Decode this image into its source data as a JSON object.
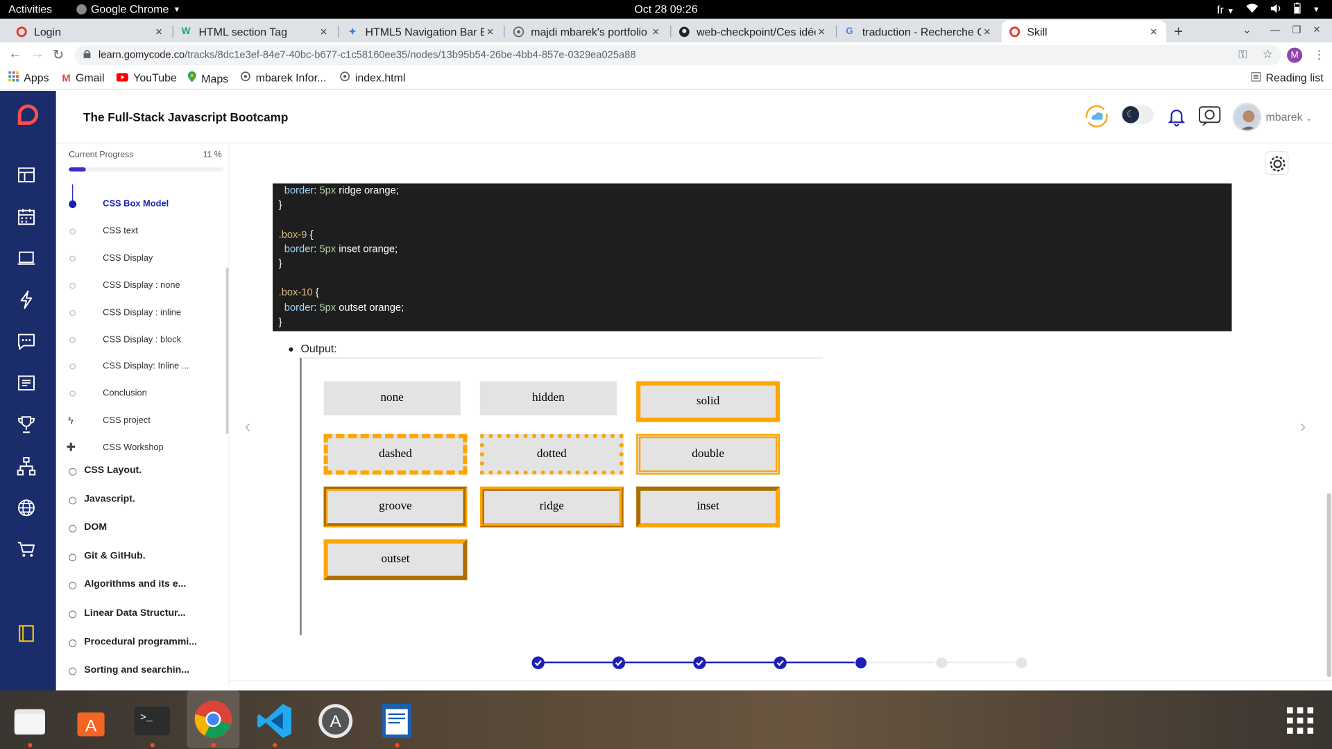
{
  "os": {
    "activities": "Activities",
    "app_name": "Google Chrome",
    "clock": "Oct 28  09:26",
    "lang": "fr"
  },
  "tabs": [
    {
      "title": "Login",
      "favicon": "gomycode-icon"
    },
    {
      "title": "HTML section Tag",
      "favicon": "w3schools-icon"
    },
    {
      "title": "HTML5 Navigation Bar Ex",
      "favicon": "codepen-icon"
    },
    {
      "title": "majdi mbarek's portfolio",
      "favicon": "globe-icon"
    },
    {
      "title": "web-checkpoint/Ces idée",
      "favicon": "github-icon"
    },
    {
      "title": "traduction - Recherche Go",
      "favicon": "google-icon"
    },
    {
      "title": "Skill",
      "favicon": "gomycode-icon"
    }
  ],
  "address": {
    "host": "learn.gomycode.co",
    "path": "/tracks/8dc1e3ef-84e7-40bc-b677-c1c58160ee35/nodes/13b95b54-26be-4bb4-857e-0329ea025a88",
    "profile": "M"
  },
  "bookmarks": [
    "Apps",
    "Gmail",
    "YouTube",
    "Maps",
    "mbarek Infor...",
    "index.html"
  ],
  "reading_list": "Reading list",
  "site": {
    "title": "The Full-Stack Javascript Bootcamp",
    "user": "mbarek"
  },
  "progress": {
    "label": "Current Progress",
    "percent_text": "11 %",
    "percent": 0.11
  },
  "sidebar": {
    "lessons": [
      {
        "label": "CSS Box Model",
        "active": true
      },
      {
        "label": "CSS text"
      },
      {
        "label": "CSS Display"
      },
      {
        "label": "CSS Display : none"
      },
      {
        "label": "CSS Display : inline"
      },
      {
        "label": "CSS Display : block"
      },
      {
        "label": "CSS Display: Inline ..."
      },
      {
        "label": "Conclusion"
      },
      {
        "label": "CSS project",
        "icon": "lightning-icon"
      },
      {
        "label": "CSS Workshop",
        "icon": "puzzle-icon"
      }
    ],
    "sections": [
      "CSS Layout.",
      "Javascript.",
      "DOM",
      "Git & GitHub.",
      "Algorithms and its e...",
      "Linear Data Structur...",
      "Procedural programmi...",
      "Sorting and searchin..."
    ]
  },
  "code": {
    "l1_prop": "border",
    "l1_num": "5px",
    "l1_rest": " ridge orange;",
    "brace_close": "}",
    "sel9": ".box-9",
    "brace_open": " {",
    "l4_prop": "border",
    "l4_num": "5px",
    "l4_rest": " inset orange;",
    "sel10": ".box-10",
    "l7_prop": "border",
    "l7_num": "5px",
    "l7_rest": " outset orange;"
  },
  "output": {
    "label": "Output:",
    "boxes": [
      "none",
      "hidden",
      "solid",
      "dashed",
      "dotted",
      "double",
      "groove",
      "ridge",
      "inset",
      "outset"
    ]
  },
  "stepper": {
    "total": 7,
    "completed": 4,
    "current": 5
  },
  "colors": {
    "brand_navy": "#1a2c6a",
    "accent_blue": "#1a1fb8",
    "box_orange": "#ffa500"
  }
}
